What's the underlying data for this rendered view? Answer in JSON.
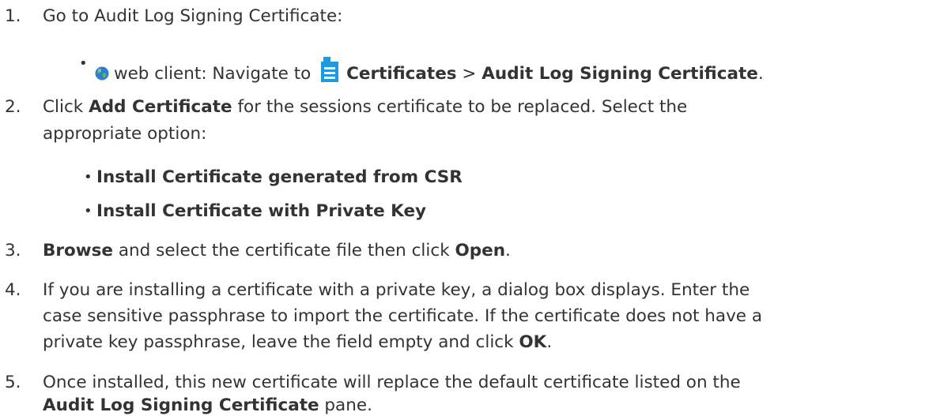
{
  "steps": [
    {
      "number": "1.",
      "text": "Go to Audit Log Signing Certificate:",
      "bullets": [
        {
          "client": "web client: Navigate to ",
          "icon_globe": "globe-icon",
          "icon_cert": "certificate-document-icon",
          "nav_1": "Certificates",
          "sep": " > ",
          "nav_2": "Audit Log Signing Certificate",
          "end": "."
        }
      ]
    },
    {
      "number": "2.",
      "pre": "Click ",
      "bold": "Add Certificate",
      "post": " for the sessions certificate to be replaced. Select the",
      "line2": "appropriate option:",
      "bullets": [
        {
          "text": "Install Certificate generated from CSR"
        },
        {
          "text": "Install Certificate with Private Key"
        }
      ]
    },
    {
      "number": "3.",
      "bold1": "Browse",
      "mid": " and select the certificate file then click ",
      "bold2": "Open",
      "end": "."
    },
    {
      "number": "4.",
      "line1": "If you are installing a certificate with a private key, a dialog box displays. Enter the",
      "line2": "case sensitive passphrase to import the certificate. If the certificate does not have a",
      "line3_pre": "private key passphrase, leave the field empty and click ",
      "line3_bold": "OK",
      "line3_end": "."
    },
    {
      "number": "5.",
      "line1": "Once installed, this new certificate will replace the default certificate listed on the",
      "line2_bold": "Audit Log Signing Certificate",
      "line2_end": " pane."
    }
  ],
  "colors": {
    "text": "#333333",
    "globe_blue": "#2a7fd4",
    "globe_green": "#6cb33f",
    "cert_blue": "#1e9be0"
  }
}
